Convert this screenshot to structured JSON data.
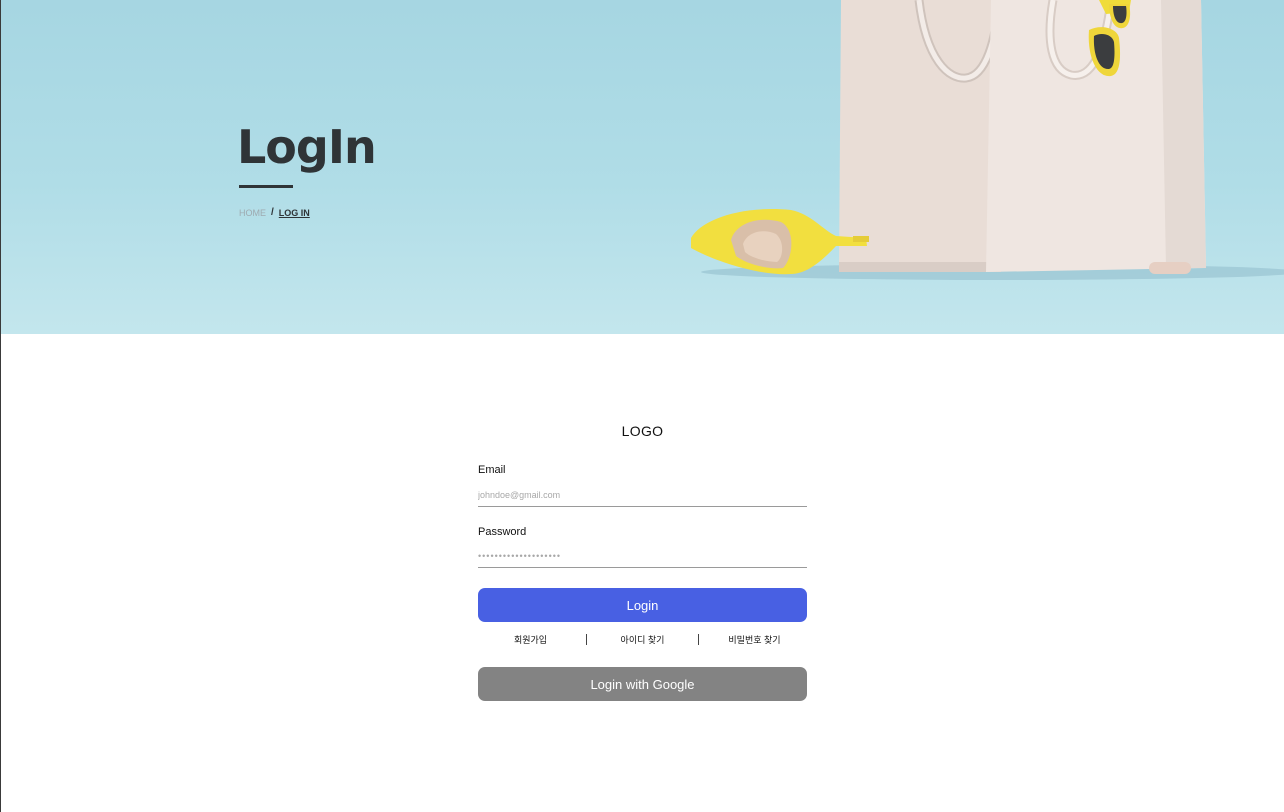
{
  "hero": {
    "title": "LogIn",
    "breadcrumb": {
      "home": "HOME",
      "separator": "/",
      "current": "LOG IN"
    }
  },
  "login": {
    "logo": "LOGO",
    "email": {
      "label": "Email",
      "placeholder": "johndoe@gmail.com"
    },
    "password": {
      "label": "Password",
      "placeholder": "••••••••••••••••••••"
    },
    "login_button": "Login",
    "links": [
      "회원가입",
      "아이디 찾기",
      "비밀번호 찾기"
    ],
    "google_button": "Login with Google"
  },
  "colors": {
    "hero_bg": "#a6d6e2",
    "primary": "#4860e3",
    "secondary": "#838383",
    "text": "#2f3437"
  }
}
